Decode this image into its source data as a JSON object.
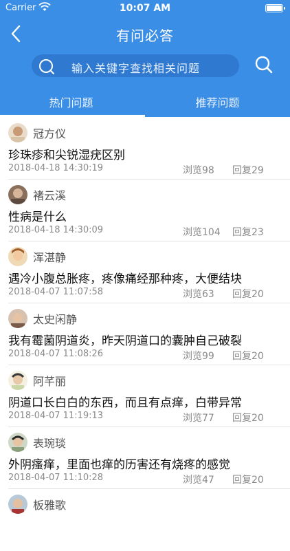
{
  "status": {
    "carrier": "Carrier",
    "time": "10:07 AM"
  },
  "header": {
    "title": "有问必答",
    "search_placeholder": "输入关键字查找相关问题",
    "tabs": [
      {
        "label": "热门问题",
        "active": true
      },
      {
        "label": "推荐问题",
        "active": false
      }
    ]
  },
  "colors": {
    "brand": "#3a8ee6",
    "search_bg": "#2f7ad0"
  },
  "items": [
    {
      "name": "冠方仪",
      "question": "珍珠疹和尖锐湿疣区别",
      "date": "2018-04-18 14:30:19",
      "views": "浏览98",
      "replies": "回复29"
    },
    {
      "name": "褚云溪",
      "question": "性病是什么",
      "date": "2018-04-18 14:30:09",
      "views": "浏览104",
      "replies": "回复23"
    },
    {
      "name": "浑湛静",
      "question": "遇冷小腹总胀疼，疼像痛经那种疼，大便结块",
      "date": "2018-04-07 11:07:58",
      "views": "浏览63",
      "replies": "回复20"
    },
    {
      "name": "太史闲静",
      "question": "我有霉菌阴道炎，昨天阴道口的囊肿自己破裂",
      "date": "2018-04-07 11:08:26",
      "views": "浏览99",
      "replies": "回复20"
    },
    {
      "name": "阿芊丽",
      "question": "阴道口长白白的东西，而且有点痒，白带异常",
      "date": "2018-04-07 11:19:13",
      "views": "浏览77",
      "replies": "回复20"
    },
    {
      "name": "表琬琰",
      "question": "外阴瘙痒，里面也痒的历害还有烧疼的感觉",
      "date": "2018-04-07 11:10:28",
      "views": "浏览47",
      "replies": "回复20"
    },
    {
      "name": "板雅歌",
      "question": "",
      "date": "",
      "views": "",
      "replies": ""
    }
  ]
}
